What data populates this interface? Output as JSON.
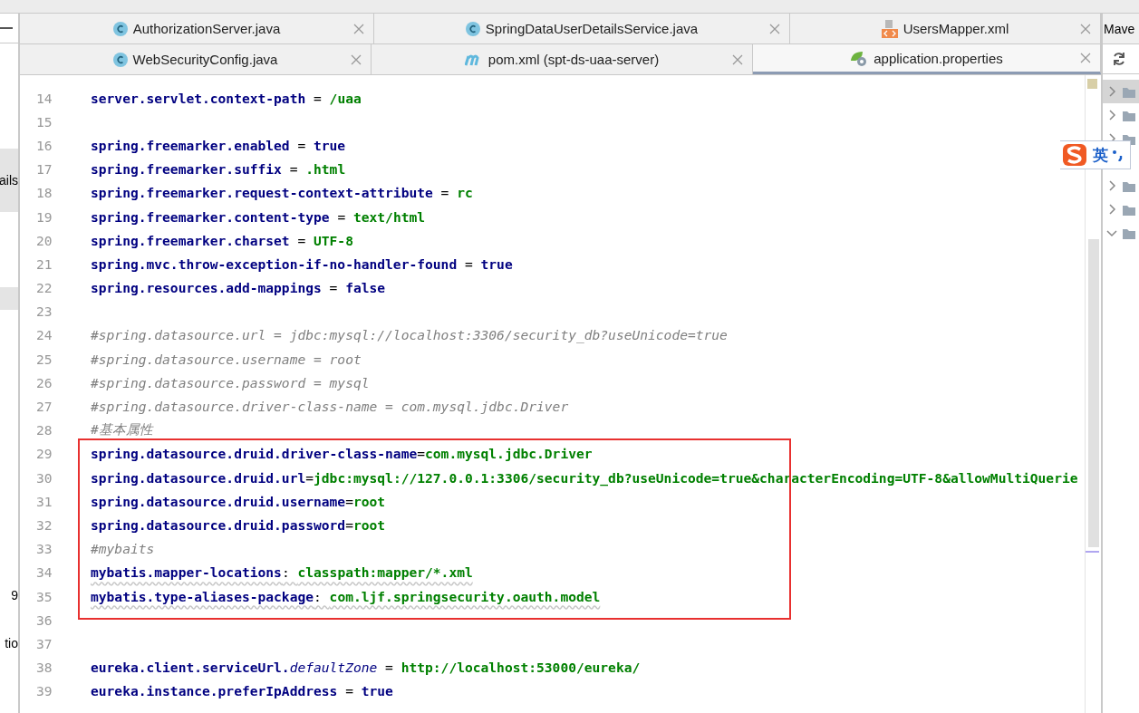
{
  "left_panel": {
    "fragments": [
      {
        "text": "ails",
        "selected": true
      },
      {
        "selected": true
      },
      {
        "text": "9",
        "selected": false
      },
      {
        "text": "tio",
        "selected": false
      }
    ]
  },
  "tab_rows": [
    [
      {
        "label": "AuthorizationServer.java",
        "kind": "class",
        "selected": false
      },
      {
        "label": "SpringDataUserDetailsService.java",
        "kind": "class",
        "selected": false
      },
      {
        "label": "UsersMapper.xml",
        "kind": "xml",
        "selected": false
      }
    ],
    [
      {
        "label": "WebSecurityConfig.java",
        "kind": "class",
        "selected": false
      },
      {
        "label": "pom.xml (spt-ds-uaa-server)",
        "kind": "maven",
        "selected": false
      },
      {
        "label": "application.properties",
        "kind": "spring",
        "selected": true
      }
    ]
  ],
  "editor": {
    "lines": [
      {
        "number": "14",
        "segments": [
          {
            "kind": "key",
            "text": "server.servlet.context-path"
          },
          {
            "kind": "op",
            "text": " = "
          },
          {
            "kind": "value",
            "text": "/uaa"
          }
        ]
      },
      {
        "number": "15"
      },
      {
        "number": "16",
        "segments": [
          {
            "kind": "key",
            "text": "spring.freemarker.enabled"
          },
          {
            "kind": "op",
            "text": " = "
          },
          {
            "kind": "key",
            "text": "true"
          }
        ]
      },
      {
        "number": "17",
        "segments": [
          {
            "kind": "key",
            "text": "spring.freemarker.suffix"
          },
          {
            "kind": "op",
            "text": " = "
          },
          {
            "kind": "value",
            "text": ".html"
          }
        ]
      },
      {
        "number": "18",
        "segments": [
          {
            "kind": "key",
            "text": "spring.freemarker.request-context-attribute"
          },
          {
            "kind": "op",
            "text": " = "
          },
          {
            "kind": "value",
            "text": "rc"
          }
        ]
      },
      {
        "number": "19",
        "segments": [
          {
            "kind": "key",
            "text": "spring.freemarker.content-type"
          },
          {
            "kind": "op",
            "text": " = "
          },
          {
            "kind": "value",
            "text": "text/html"
          }
        ]
      },
      {
        "number": "20",
        "segments": [
          {
            "kind": "key",
            "text": "spring.freemarker.charset"
          },
          {
            "kind": "op",
            "text": " = "
          },
          {
            "kind": "value",
            "text": "UTF-8"
          }
        ]
      },
      {
        "number": "21",
        "segments": [
          {
            "kind": "key",
            "text": "spring.mvc.throw-exception-if-no-handler-found"
          },
          {
            "kind": "op",
            "text": " = "
          },
          {
            "kind": "key",
            "text": "true"
          }
        ]
      },
      {
        "number": "22",
        "segments": [
          {
            "kind": "key",
            "text": "spring.resources.add-mappings"
          },
          {
            "kind": "op",
            "text": " = "
          },
          {
            "kind": "key",
            "text": "false"
          }
        ]
      },
      {
        "number": "23"
      },
      {
        "number": "24",
        "segments": [
          {
            "kind": "comment",
            "text": "#spring.datasource.url = jdbc:mysql://localhost:3306/security_db?useUnicode=true"
          }
        ]
      },
      {
        "number": "25",
        "segments": [
          {
            "kind": "comment",
            "text": "#spring.datasource.username = root"
          }
        ]
      },
      {
        "number": "26",
        "segments": [
          {
            "kind": "comment",
            "text": "#spring.datasource.password = mysql"
          }
        ]
      },
      {
        "number": "27",
        "segments": [
          {
            "kind": "comment",
            "text": "#spring.datasource.driver-class-name = com.mysql.jdbc.Driver"
          }
        ]
      },
      {
        "number": "28",
        "segments": [
          {
            "kind": "comment",
            "text": "#基本属性"
          }
        ]
      }
    ],
    "highlighted_lines": [
      {
        "number": "29",
        "segments": [
          {
            "kind": "key",
            "text": "spring.datasource.druid.driver-class-name"
          },
          {
            "kind": "op",
            "text": "="
          },
          {
            "kind": "value",
            "text": "com.mysql.jdbc.Driver"
          }
        ]
      },
      {
        "number": "30",
        "segments": [
          {
            "kind": "key",
            "text": "spring.datasource.druid.url"
          },
          {
            "kind": "op",
            "text": "="
          },
          {
            "kind": "value",
            "text": "jdbc:mysql://127.0.0.1:3306/security_db?useUnicode=true&characterEncoding=UTF-8&allowMultiQuerie"
          }
        ]
      },
      {
        "number": "31",
        "segments": [
          {
            "kind": "key",
            "text": "spring.datasource.druid.username"
          },
          {
            "kind": "op",
            "text": "="
          },
          {
            "kind": "value",
            "text": "root"
          }
        ]
      },
      {
        "number": "32",
        "segments": [
          {
            "kind": "key",
            "text": "spring.datasource.druid.password"
          },
          {
            "kind": "op",
            "text": "="
          },
          {
            "kind": "value",
            "text": "root"
          }
        ]
      },
      {
        "number": "33",
        "segments": [
          {
            "kind": "comment",
            "text": "#mybaits"
          }
        ]
      },
      {
        "number": "34",
        "segments": [
          {
            "kind": "key-warn",
            "text": "mybatis.mapper-locations"
          },
          {
            "kind": "op-warn",
            "text": ": "
          },
          {
            "kind": "value-warn",
            "text": "classpath:mapper/*.xml"
          }
        ]
      },
      {
        "number": "35",
        "segments": [
          {
            "kind": "key-warn",
            "text": "mybatis.type-aliases-package"
          },
          {
            "kind": "op-warn",
            "text": ": "
          },
          {
            "kind": "value-warn",
            "text": "com.ljf.springsecurity.oauth.model"
          }
        ]
      }
    ],
    "lines_after": [
      {
        "number": "36"
      },
      {
        "number": "37"
      },
      {
        "number": "38",
        "segments": [
          {
            "kind": "key",
            "text": "eureka.client.serviceUrl."
          },
          {
            "kind": "key-italic",
            "text": "defaultZone"
          },
          {
            "kind": "op",
            "text": " = "
          },
          {
            "kind": "value",
            "text": "http://localhost:53000/eureka/"
          }
        ]
      },
      {
        "number": "39",
        "segments": [
          {
            "kind": "key",
            "text": "eureka.instance.preferIpAddress"
          },
          {
            "kind": "op",
            "text": " = "
          },
          {
            "kind": "key",
            "text": "true"
          }
        ]
      }
    ]
  },
  "maven_panel": {
    "title": "Mave",
    "rows": [
      {
        "expanded": false,
        "selected": true
      },
      {
        "expanded": false,
        "selected": false
      },
      {
        "expanded": false,
        "selected": false
      },
      {
        "expanded": false,
        "selected": false
      },
      {
        "expanded": false,
        "selected": false
      },
      {
        "expanded": true,
        "selected": false
      }
    ]
  },
  "ime_bar": {
    "label": "英"
  }
}
